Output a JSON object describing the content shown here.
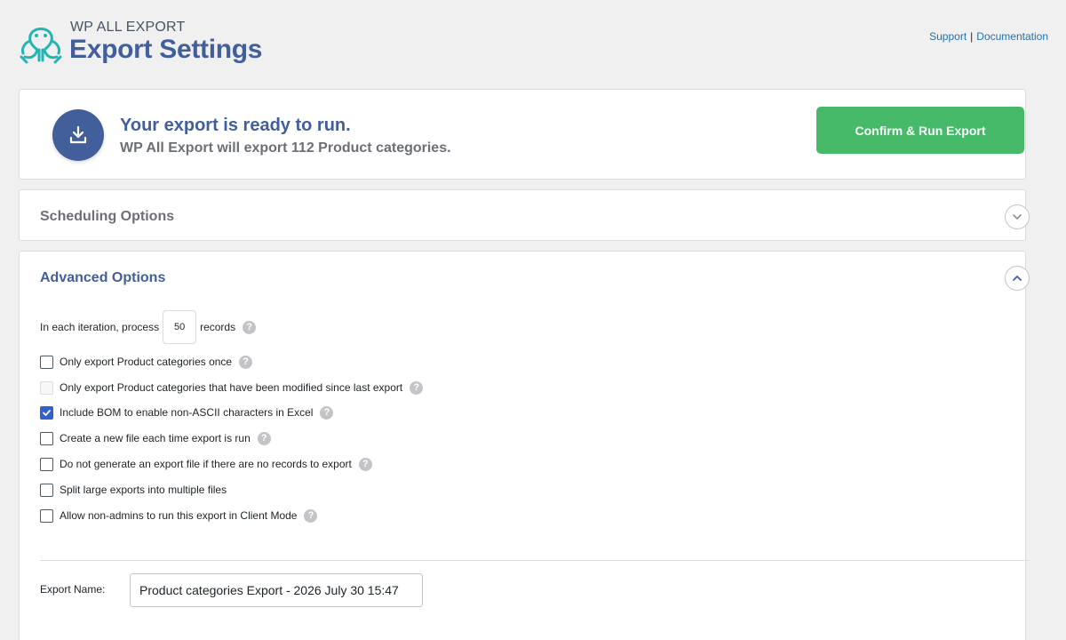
{
  "header": {
    "brand_sub": "WP ALL EXPORT",
    "brand_title": "Export Settings",
    "links": {
      "support": "Support",
      "separator": "|",
      "documentation": "Documentation"
    }
  },
  "ready": {
    "title": "Your export is ready to run.",
    "subtitle": "WP All Export will export 112 Product categories.",
    "run_button": "Confirm & Run Export"
  },
  "scheduling": {
    "title": "Scheduling Options"
  },
  "advanced": {
    "title": "Advanced Options",
    "iteration": {
      "prefix": "In each iteration, process",
      "value": "50",
      "suffix": "records"
    },
    "options": [
      {
        "label": "Only export Product categories once",
        "checked": false,
        "disabled": false,
        "help": true
      },
      {
        "label": "Only export Product categories that have been modified since last export",
        "checked": false,
        "disabled": true,
        "help": true
      },
      {
        "label": "Include BOM to enable non-ASCII characters in Excel",
        "checked": true,
        "disabled": false,
        "help": true
      },
      {
        "label": "Create a new file each time export is run",
        "checked": false,
        "disabled": false,
        "help": true
      },
      {
        "label": "Do not generate an export file if there are no records to export",
        "checked": false,
        "disabled": false,
        "help": true
      },
      {
        "label": "Split large exports into multiple files",
        "checked": false,
        "disabled": false,
        "help": false
      },
      {
        "label": "Allow non-admins to run this export in Client Mode",
        "checked": false,
        "disabled": false,
        "help": true
      }
    ],
    "export_name": {
      "label": "Export Name:",
      "value": "Product categories Export - 2026 July 30 15:47"
    }
  },
  "colors": {
    "brand_blue": "#425f9c",
    "teal_logo": "#23b4b4",
    "run_green": "#46ba69",
    "checkbox_blue": "#2f61d5"
  },
  "icons": {
    "logo": "octopus-logo-icon",
    "ready": "download-tray-icon",
    "help": "question-mark-icon",
    "expand": "chevron-down-icon",
    "collapse": "chevron-up-icon",
    "check": "checkmark-icon"
  }
}
